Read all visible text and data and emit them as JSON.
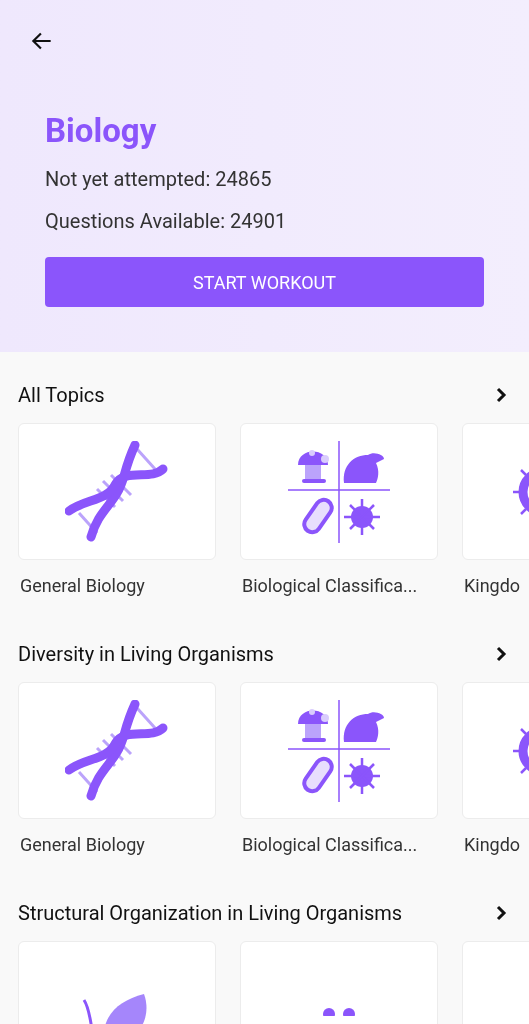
{
  "header": {
    "title": "Biology",
    "stats": [
      "Not yet attempted: 24865",
      "Questions Available: 24901"
    ],
    "button": "START WORKOUT"
  },
  "sections": [
    {
      "title": "All Topics",
      "cards": [
        {
          "kind": "dna",
          "label": "General Biology"
        },
        {
          "kind": "classification",
          "label": "Biological Classifica..."
        },
        {
          "kind": "cell",
          "label": "Kingdo"
        }
      ]
    },
    {
      "title": "Diversity in Living Organisms",
      "cards": [
        {
          "kind": "dna",
          "label": "General Biology"
        },
        {
          "kind": "classification",
          "label": "Biological Classifica..."
        },
        {
          "kind": "cell",
          "label": "Kingdo"
        }
      ]
    },
    {
      "title": "Structural Organization in Living Organisms",
      "cards": [
        {
          "kind": "leaf"
        },
        {
          "kind": "dots"
        },
        {
          "kind": "blank"
        }
      ]
    }
  ]
}
